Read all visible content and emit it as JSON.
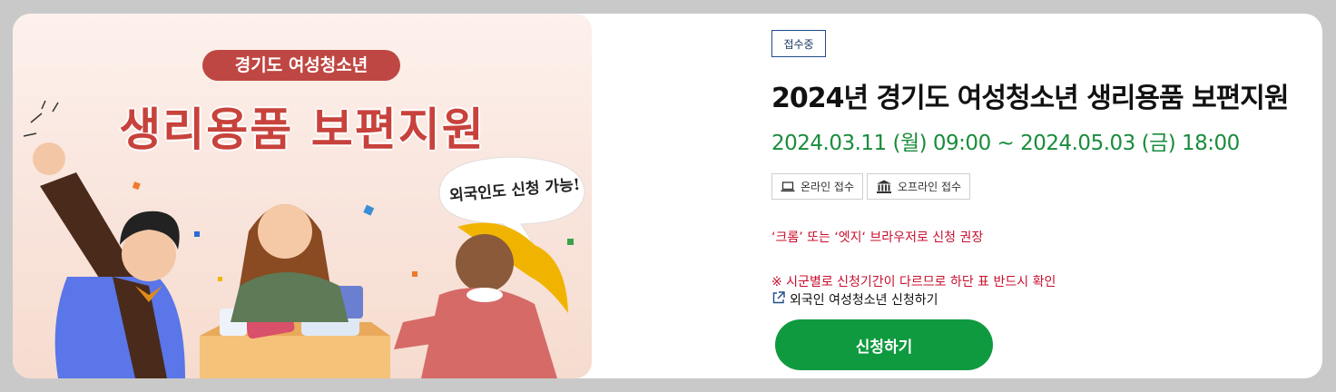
{
  "banner": {
    "subtitle": "경기도 여성청소년",
    "title": "생리용품 보편지원",
    "bubble": "외국인도 신청 가능!"
  },
  "status_badge": "접수중",
  "program": {
    "title": "2024년 경기도 여성청소년 생리용품 보편지원",
    "period": "2024.03.11 (월) 09:00 ~ 2024.05.03 (금) 18:00"
  },
  "tags": [
    {
      "icon": "laptop-icon",
      "label": "온라인 접수"
    },
    {
      "icon": "building-icon",
      "label": "오프라인 접수"
    }
  ],
  "notices": {
    "browser": "‘크롬’ 또는 ‘엣지‘ 브라우저로 신청 권장",
    "period_note": "※ 시군별로 신청기간이 다르므로 하단 표 반드시 확인"
  },
  "foreign_link": "외국인 여성청소년 신청하기",
  "apply_button": "신청하기",
  "colors": {
    "green": "#0f9a3f",
    "red_text": "#c8102e",
    "banner_red": "#c8423c"
  }
}
